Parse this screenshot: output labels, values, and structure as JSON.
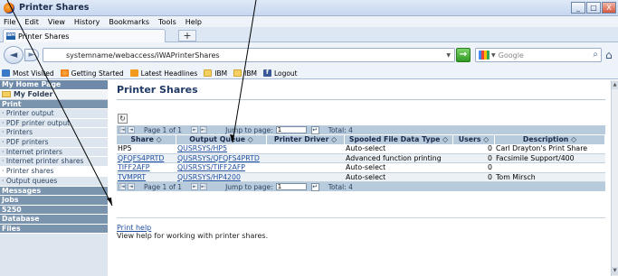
{
  "window": {
    "title": "Printer Shares",
    "btn_min": "_",
    "btn_max": "□",
    "btn_close": "X"
  },
  "menu": [
    "File",
    "Edit",
    "View",
    "History",
    "Bookmarks",
    "Tools",
    "Help"
  ],
  "tab": {
    "favicon_text": "IBM",
    "label": "Printer Shares",
    "new_tab": "+"
  },
  "nav": {
    "back": "◄",
    "forward": "►",
    "url": "systemname/webaccess/iWAPrinterShares",
    "go": "→",
    "search_placeholder": "Google",
    "search_icon": "magnifier-icon",
    "home": "⌂"
  },
  "bookmarks": [
    "Most Visited",
    "Getting Started",
    "Latest Headlines",
    "IBM",
    "IBM",
    "Logout"
  ],
  "sidebar": {
    "home": "My Home Page",
    "folder": "My Folder",
    "print_section": "Print",
    "print_items": [
      "· Printer output",
      "· PDF printer output",
      "· Printers",
      "· PDF printers",
      "· Internet printers",
      "· Internet printer shares",
      "· Printer shares",
      "· Output queues"
    ],
    "sections_after": [
      "Messages",
      "Jobs",
      "5250",
      "Database",
      "Files"
    ]
  },
  "main": {
    "title": "Printer Shares",
    "refresh": "↻",
    "pager": {
      "page_text": "Page 1 of 1",
      "jump_label": "Jump to page:",
      "jump_value": "1",
      "total": "Total: 4"
    },
    "columns": [
      "Share ◇",
      "Output Queue ◇",
      "Printer Driver ◇",
      "Spooled File Data Type ◇",
      "Users ◇",
      "Description ◇"
    ],
    "rows": [
      {
        "share": "HP5",
        "queue": "QUSRSYS/HP5",
        "driver": "",
        "type": "Auto-select",
        "users": "0",
        "desc": "Carl Drayton's Print Share"
      },
      {
        "share": "QFQFS4PRTD",
        "queue": "QUSRSYS/QFQFS4PRTD",
        "driver": "",
        "type": "Advanced function printing",
        "users": "0",
        "desc": "Facsimile Support/400"
      },
      {
        "share": "TIFF2AFP",
        "queue": "QUSRSYS/TIFF2AFP",
        "driver": "",
        "type": "Auto-select",
        "users": "0",
        "desc": ""
      },
      {
        "share": "TVMPRT",
        "queue": "QUSRSYS/HP4200",
        "driver": "",
        "type": "Auto-select",
        "users": "0",
        "desc": "Tom Mirsch"
      }
    ],
    "help_link": "Print help",
    "help_desc": "View help for working with printer shares."
  }
}
